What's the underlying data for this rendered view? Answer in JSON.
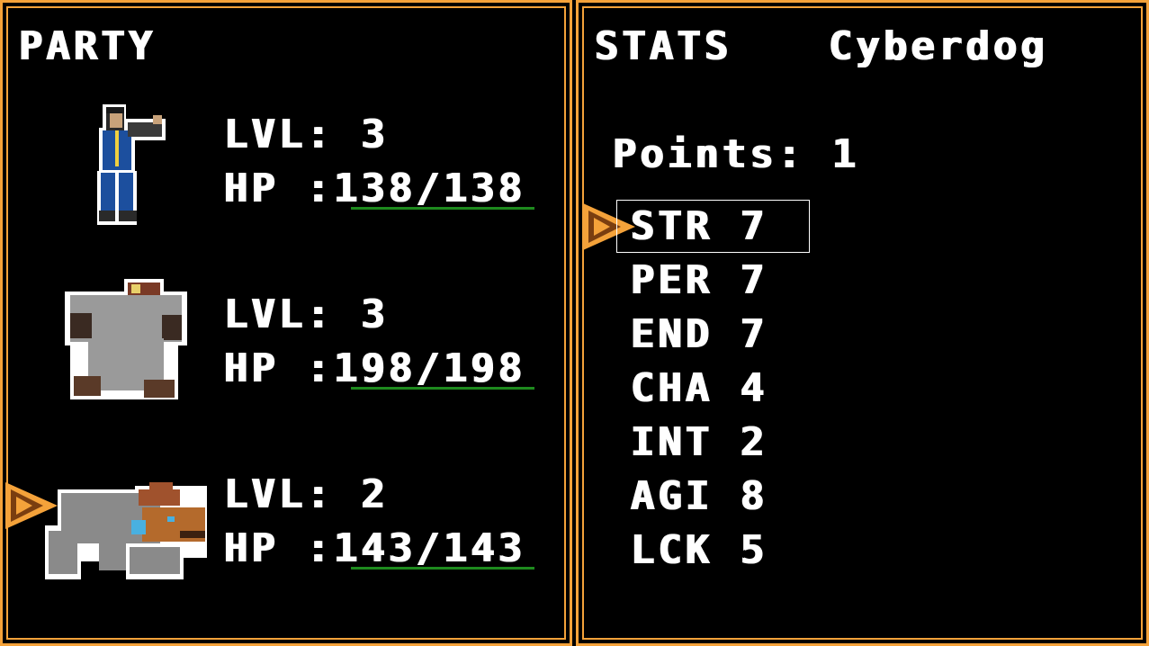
{
  "party": {
    "title": "PARTY",
    "members": [
      {
        "name": "Vault Dweller",
        "sprite": "vault-dweller-sprite",
        "lvl_text": "LVL: 3",
        "hp_text": "HP :138/138",
        "hp_fraction": 1.0
      },
      {
        "name": "Super Mutant",
        "sprite": "super-mutant-sprite",
        "lvl_text": "LVL: 3",
        "hp_text": "HP :198/198",
        "hp_fraction": 1.0
      },
      {
        "name": "Cyberdog",
        "sprite": "cyberdog-sprite",
        "lvl_text": "LVL: 2",
        "hp_text": "HP :143/143",
        "hp_fraction": 1.0
      }
    ],
    "selected_member_index": 2
  },
  "stats": {
    "title": "STATS",
    "member_name": "Cyberdog",
    "points_text": "Points: 1",
    "rows": [
      {
        "label": "STR 7"
      },
      {
        "label": "PER 7"
      },
      {
        "label": "END 7"
      },
      {
        "label": "CHA 4"
      },
      {
        "label": "INT 2"
      },
      {
        "label": "AGI 8"
      },
      {
        "label": "LCK 5"
      }
    ],
    "selected_row_index": 0
  },
  "colors": {
    "border": "#f4a23a",
    "hp_bar": "#1e8a1e",
    "cursor": "#f4a23a",
    "background": "#000000",
    "text": "#ffffff"
  }
}
